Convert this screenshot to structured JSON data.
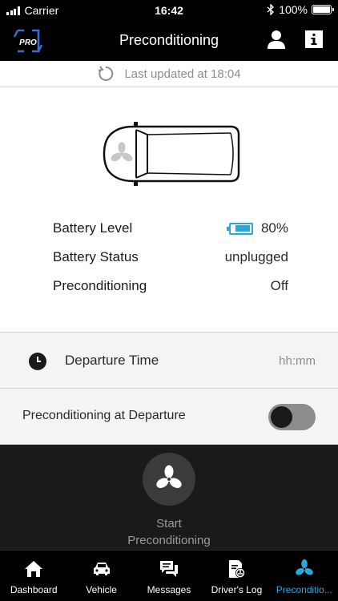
{
  "status_bar": {
    "carrier": "Carrier",
    "time": "16:42",
    "battery": "100%"
  },
  "nav": {
    "logo_text": "PRO",
    "title": "Preconditioning"
  },
  "updated": {
    "text": "Last updated at 18:04"
  },
  "status": {
    "battery_level_label": "Battery Level",
    "battery_level_value": "80%",
    "battery_level_fraction": 0.8,
    "battery_status_label": "Battery Status",
    "battery_status_value": "unplugged",
    "preconditioning_label": "Preconditioning",
    "preconditioning_value": "Off"
  },
  "departure": {
    "label": "Departure Time",
    "placeholder": "hh:mm"
  },
  "precondition_departure": {
    "label": "Preconditioning at Departure",
    "enabled": false
  },
  "start": {
    "label_line1": "Start",
    "label_line2": "Preconditioning"
  },
  "tabs": [
    {
      "label": "Dashboard",
      "icon": "home-icon"
    },
    {
      "label": "Vehicle",
      "icon": "car-icon"
    },
    {
      "label": "Messages",
      "icon": "messages-icon"
    },
    {
      "label": "Driver's Log",
      "icon": "drivers-log-icon"
    },
    {
      "label": "Preconditio...",
      "icon": "fan-icon",
      "active": true
    }
  ],
  "colors": {
    "accent": "#29a8e0",
    "header_bg": "#000000",
    "dark_panel": "#1a1a1a",
    "muted_text": "#8e8e8e"
  }
}
